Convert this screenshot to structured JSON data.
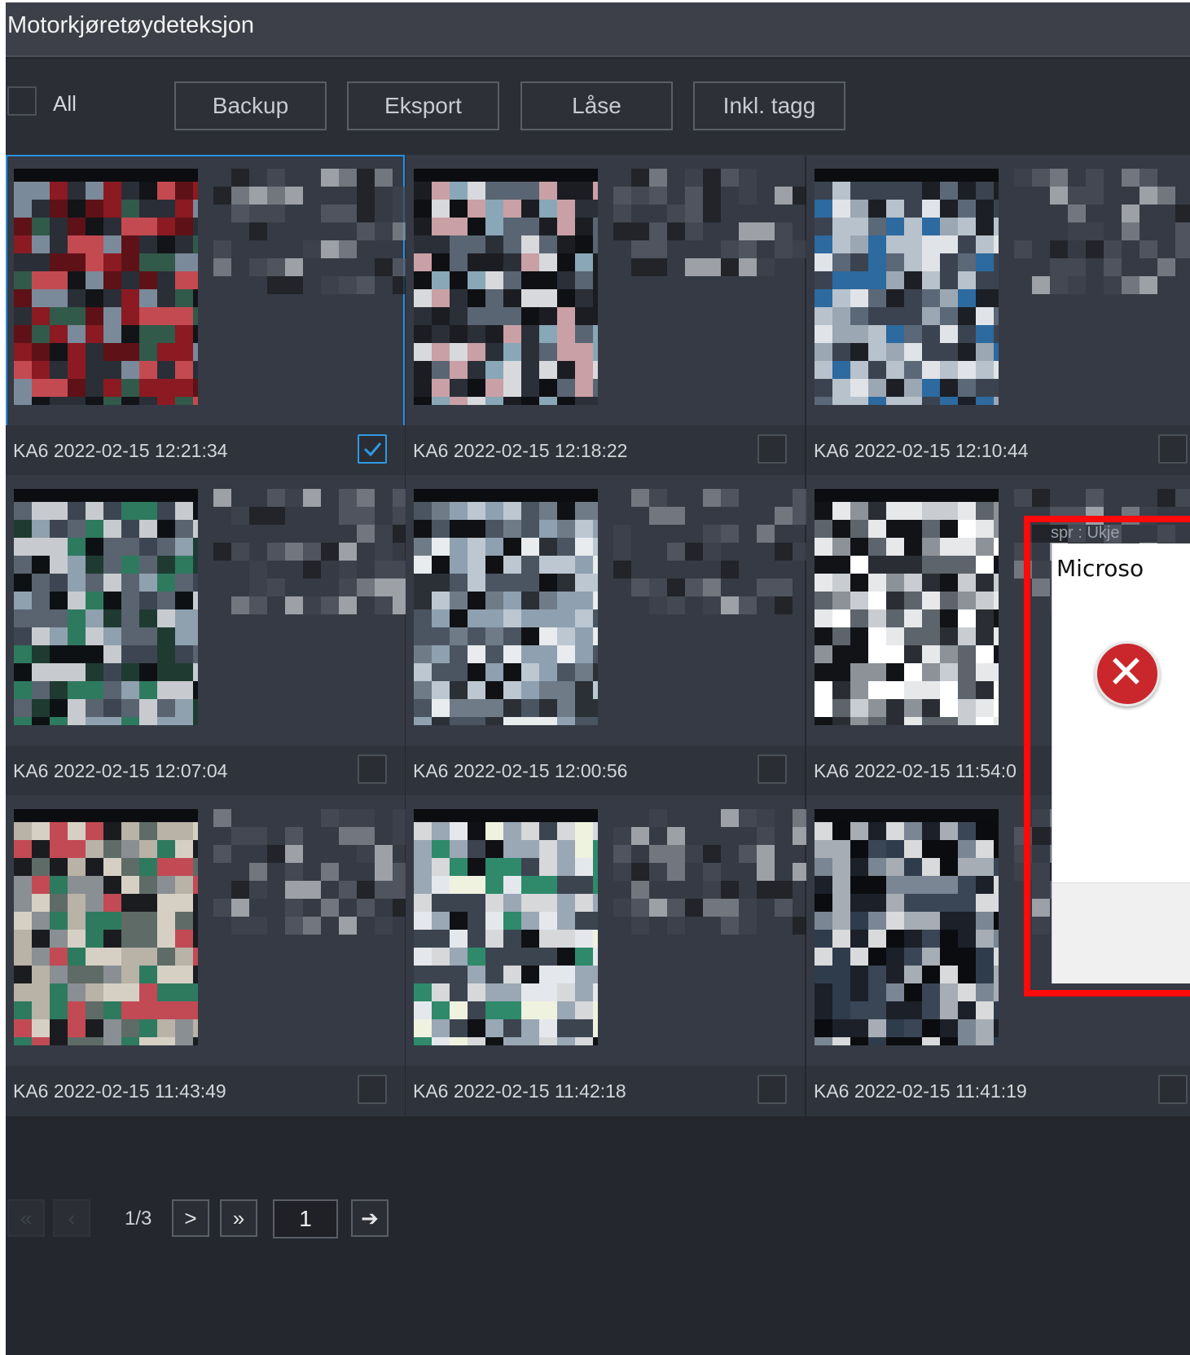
{
  "title": "Motorkjøretøydeteksjon",
  "toolbar": {
    "all_label": "All",
    "buttons": [
      "Backup",
      "Eksport",
      "Låse",
      "Inkl. tagg"
    ]
  },
  "cards": [
    {
      "label": "KA6 2022-02-15 12:21:34",
      "checked": true
    },
    {
      "label": "KA6 2022-02-15 12:18:22",
      "checked": false
    },
    {
      "label": "KA6 2022-02-15 12:10:44",
      "checked": false
    },
    {
      "label": "KA6 2022-02-15 12:07:04",
      "checked": false
    },
    {
      "label": "KA6 2022-02-15 12:00:56",
      "checked": false
    },
    {
      "label": "KA6 2022-02-15 11:54:0",
      "checked": false
    },
    {
      "label": "KA6 2022-02-15 11:43:49",
      "checked": false
    },
    {
      "label": "KA6 2022-02-15 11:42:18",
      "checked": false
    },
    {
      "label": "KA6 2022-02-15 11:41:19",
      "checked": false
    }
  ],
  "pager": {
    "first": "«",
    "prev": "‹",
    "count": "1/3",
    "next": ">",
    "last": "»",
    "page_value": "1",
    "go": "➔"
  },
  "dialog": {
    "title": "Microso",
    "behind_text": "spr : Ukje",
    "icon": "error-icon"
  },
  "colors": {
    "accent": "#2690de",
    "highlight": "#ff0a0a",
    "error": "#c9272b"
  }
}
